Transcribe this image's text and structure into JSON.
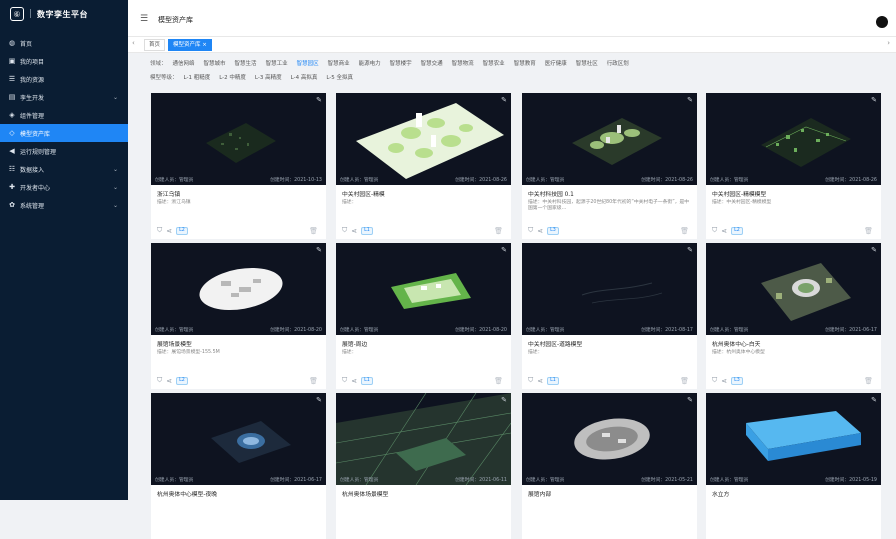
{
  "app": {
    "logo_glyph": "⑥",
    "title": "数字孪生平台"
  },
  "sidebar": {
    "items": [
      {
        "icon": "globe-icon",
        "glyph": "◍",
        "label": "首页",
        "chev": false
      },
      {
        "icon": "folder-icon",
        "glyph": "▣",
        "label": "我的项目",
        "chev": false
      },
      {
        "icon": "list-icon",
        "glyph": "☰",
        "label": "我的资源",
        "chev": false
      },
      {
        "icon": "code-icon",
        "glyph": "▤",
        "label": "孪生开发",
        "chev": true
      },
      {
        "icon": "puzzle-icon",
        "glyph": "◈",
        "label": "组件管理",
        "chev": false
      },
      {
        "icon": "cube-icon",
        "glyph": "◇",
        "label": "模型资产库",
        "chev": false,
        "active": true
      },
      {
        "icon": "send-icon",
        "glyph": "◀",
        "label": "运行规则管理",
        "chev": false
      },
      {
        "icon": "database-icon",
        "glyph": "☷",
        "label": "数据接入",
        "chev": true
      },
      {
        "icon": "developer-icon",
        "glyph": "✚",
        "label": "开发者中心",
        "chev": true
      },
      {
        "icon": "gear-icon",
        "glyph": "✿",
        "label": "系统管理",
        "chev": true
      }
    ]
  },
  "header": {
    "page_title": "模型资产库"
  },
  "tabs": {
    "left_arrow": "‹",
    "right_arrow": "›",
    "items": [
      {
        "label": "首页"
      },
      {
        "label": "模型资产库 ×",
        "active": true
      }
    ]
  },
  "filters": {
    "domain_label": "领域：",
    "domains": [
      "通信网络",
      "智慧城市",
      "智慧生活",
      "智慧工业",
      "智慧园区",
      "智慧商业",
      "能源电力",
      "智慧楼宇",
      "智慧交通",
      "智慧物流",
      "智慧农业",
      "智慧教育",
      "医疗健康",
      "智慧社区",
      "行政区划"
    ],
    "domain_selected": "智慧园区",
    "level_label": "模型等级：",
    "levels": [
      "L-1 粗糙度",
      "L-2 中精度",
      "L-3 高精度",
      "L-4 高拟真",
      "L-5 全拟真"
    ]
  },
  "cards": [
    {
      "name": "浙江乌镇",
      "desc": "描述：浙江乌镇",
      "creator": "创建人员：管理员",
      "time": "创建时间：2021-10-13",
      "level": "L2"
    },
    {
      "name": "中关村园区-精模",
      "desc": "描述：",
      "creator": "创建人员：管理员",
      "time": "创建时间：2021-08-26",
      "level": "L1"
    },
    {
      "name": "中关村科技园 0.1",
      "desc": "描述：中关村科技园，起源于20世纪80年代初的“中关村电子一条街”，是中国第一个国家级…",
      "creator": "创建人员：管理员",
      "time": "创建时间：2021-08-26",
      "level": "L3"
    },
    {
      "name": "中关村园区-精模模型",
      "desc": "描述：中关村园区-精模模型",
      "creator": "创建人员：管理员",
      "time": "创建时间：2021-08-26",
      "level": "L2"
    },
    {
      "name": "展馆场景模型",
      "desc": "描述：展馆场景模型-155.5M",
      "creator": "创建人员：管理员",
      "time": "创建时间：2021-08-20",
      "level": "L2"
    },
    {
      "name": "展馆-周边",
      "desc": "描述：",
      "creator": "创建人员：管理员",
      "time": "创建时间：2021-08-20",
      "level": "L1"
    },
    {
      "name": "中关村园区-道路模型",
      "desc": "描述：",
      "creator": "创建人员：管理员",
      "time": "创建时间：2021-08-17",
      "level": "L1"
    },
    {
      "name": "杭州奥体中心-白天",
      "desc": "描述：杭州奥体中心模型",
      "creator": "创建人员：管理员",
      "time": "创建时间：2021-06-17",
      "level": "L3"
    },
    {
      "name": "杭州奥体中心模型-夜晚",
      "desc": "",
      "creator": "创建人员：管理员",
      "time": "创建时间：2021-06-17",
      "level": ""
    },
    {
      "name": "杭州奥体场景模型",
      "desc": "",
      "creator": "创建人员：管理员",
      "time": "创建时间：2021-06-11",
      "level": ""
    },
    {
      "name": "展馆内部",
      "desc": "",
      "creator": "创建人员：管理员",
      "time": "创建时间：2021-05-21",
      "level": ""
    },
    {
      "name": "水立方",
      "desc": "",
      "creator": "创建人员：管理员",
      "time": "创建时间：2021-05-19",
      "level": ""
    }
  ]
}
